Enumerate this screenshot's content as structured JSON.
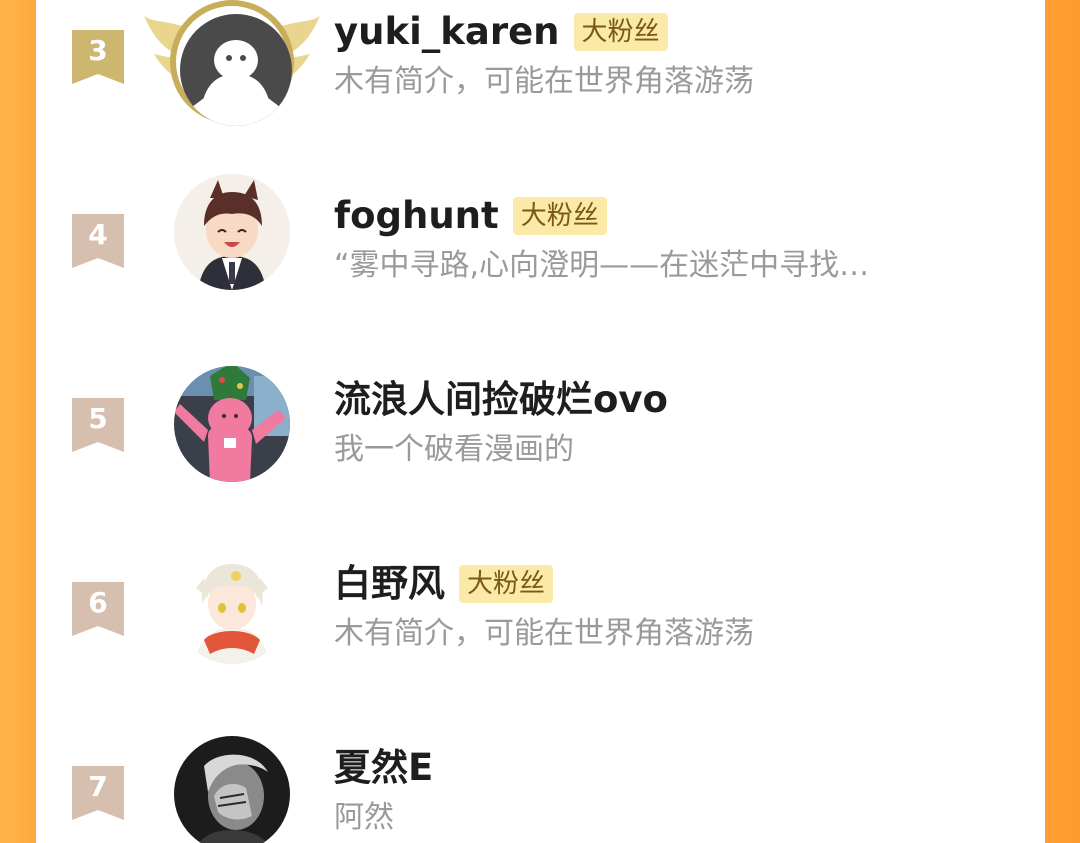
{
  "colors": {
    "rank_badge_gold": "#cdb66f",
    "rank_badge_tan": "#d6bfae",
    "badge_bg": "#fbe9a8",
    "badge_text": "#7a5a12",
    "name_text": "#1e1e1e",
    "bio_text": "#9a9a9a",
    "frame_orange": "#ffa43a"
  },
  "rows": [
    {
      "rank": "3",
      "name": "yuki_karen",
      "badge": "大粉丝",
      "bio": "木有简介，可能在世界角落游荡",
      "avatar": "default-avatar-icon",
      "frame": "winged-crown-frame"
    },
    {
      "rank": "4",
      "name": "foghunt",
      "badge": "大粉丝",
      "bio": "“雾中寻路,心向澄明——在迷茫中寻找…",
      "avatar": "anime-boy-avatar"
    },
    {
      "rank": "5",
      "name": "流浪人间捡破烂ovo",
      "badge": "",
      "bio": "我一个破看漫画的",
      "avatar": "pink-figure-avatar"
    },
    {
      "rank": "6",
      "name": "白野风",
      "badge": "大粉丝",
      "bio": "木有简介，可能在世界角落游荡",
      "avatar": "anime-girl-avatar"
    },
    {
      "rank": "7",
      "name": "夏然E",
      "badge": "",
      "bio": "阿然",
      "avatar": "monochrome-photo-avatar"
    }
  ]
}
